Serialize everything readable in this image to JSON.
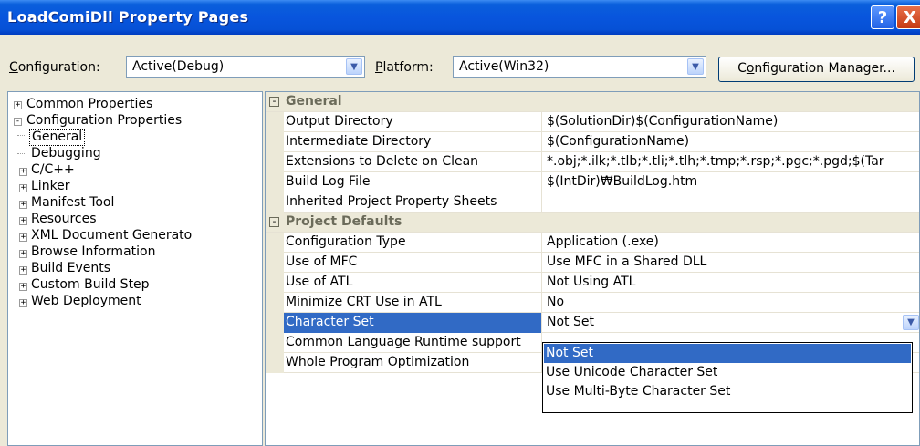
{
  "window": {
    "title": "LoadComiDll Property Pages",
    "help_glyph": "?",
    "close_glyph": "X"
  },
  "config": {
    "configuration_label_u": "C",
    "configuration_label_rest": "onfiguration:",
    "configuration_value": "Active(Debug)",
    "platform_label_u": "P",
    "platform_label_rest": "latform:",
    "platform_value": "Active(Win32)",
    "manager_label_pre": "C",
    "manager_label_u": "o",
    "manager_label_rest": "nfiguration Manager..."
  },
  "tree": [
    {
      "label": "Common Properties",
      "expander": "+"
    },
    {
      "label": "Configuration Properties",
      "expander": "-"
    },
    {
      "label": "General",
      "expander": ""
    },
    {
      "label": "Debugging",
      "expander": ""
    },
    {
      "label": "C/C++",
      "expander": "+"
    },
    {
      "label": "Linker",
      "expander": "+"
    },
    {
      "label": "Manifest Tool",
      "expander": "+"
    },
    {
      "label": "Resources",
      "expander": "+"
    },
    {
      "label": "XML Document Generato",
      "expander": "+"
    },
    {
      "label": "Browse Information",
      "expander": "+"
    },
    {
      "label": "Build Events",
      "expander": "+"
    },
    {
      "label": "Custom Build Step",
      "expander": "+"
    },
    {
      "label": "Web Deployment",
      "expander": "+"
    }
  ],
  "grid": {
    "categories": [
      {
        "name": "General",
        "toggle": "-"
      },
      {
        "name": "Project Defaults",
        "toggle": "-"
      }
    ],
    "general_rows": [
      {
        "name": "Output Directory",
        "value": "$(SolutionDir)$(ConfigurationName)"
      },
      {
        "name": "Intermediate Directory",
        "value": "$(ConfigurationName)"
      },
      {
        "name": "Extensions to Delete on Clean",
        "value": "*.obj;*.ilk;*.tlb;*.tli;*.tlh;*.tmp;*.rsp;*.pgc;*.pgd;$(Tar"
      },
      {
        "name": "Build Log File",
        "value": "$(IntDir)₩BuildLog.htm"
      },
      {
        "name": "Inherited Project Property Sheets",
        "value": ""
      }
    ],
    "defaults_rows": [
      {
        "name": "Configuration Type",
        "value": "Application (.exe)"
      },
      {
        "name": "Use of MFC",
        "value": "Use MFC in a Shared DLL"
      },
      {
        "name": "Use of ATL",
        "value": "Not Using ATL"
      },
      {
        "name": "Minimize CRT Use in ATL",
        "value": "No"
      },
      {
        "name": "Character Set",
        "value": "Not Set"
      },
      {
        "name": "Common Language Runtime support",
        "value": ""
      },
      {
        "name": "Whole Program Optimization",
        "value": ""
      }
    ],
    "dropdown_options": [
      "Not Set",
      "Use Unicode Character Set",
      "Use Multi-Byte Character Set"
    ],
    "selected_row": "Character Set",
    "highlighted_option": "Not Set"
  },
  "colors": {
    "titlebar": "#0855dd",
    "selection": "#316ac5",
    "dialog_bg": "#ece9d8"
  }
}
